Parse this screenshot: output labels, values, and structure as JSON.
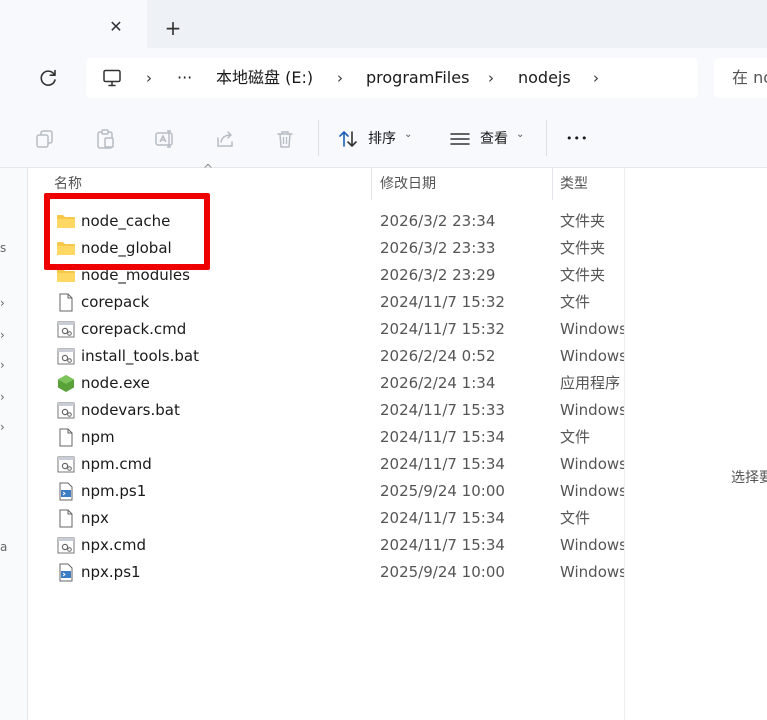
{
  "tab": {
    "close_glyph": "✕",
    "new_glyph": "+"
  },
  "address": {
    "overflow": "···",
    "crumbs": [
      "本地磁盘 (E:)",
      "programFiles",
      "nodejs"
    ],
    "separator": "›"
  },
  "search": {
    "placeholder": "在 no"
  },
  "toolbar": {
    "sort_label": "排序",
    "view_label": "查看",
    "more_glyph": "•••",
    "chevron": "⌄"
  },
  "columns": {
    "name": "名称",
    "date": "修改日期",
    "type": "类型"
  },
  "files": [
    {
      "name": "node_cache",
      "date": "2026/3/2 23:34",
      "type": "文件夹",
      "icon": "folder-icon"
    },
    {
      "name": "node_global",
      "date": "2026/3/2 23:33",
      "type": "文件夹",
      "icon": "folder-icon"
    },
    {
      "name": "node_modules",
      "date": "2026/3/2 23:29",
      "type": "文件夹",
      "icon": "folder-icon"
    },
    {
      "name": "corepack",
      "date": "2024/11/7 15:32",
      "type": "文件",
      "icon": "file-icon"
    },
    {
      "name": "corepack.cmd",
      "date": "2024/11/7 15:32",
      "type": "Windows",
      "icon": "batch-file-icon"
    },
    {
      "name": "install_tools.bat",
      "date": "2026/2/24 0:52",
      "type": "Windows",
      "icon": "batch-file-icon"
    },
    {
      "name": "node.exe",
      "date": "2026/2/24 1:34",
      "type": "应用程序",
      "icon": "node-exe-icon"
    },
    {
      "name": "nodevars.bat",
      "date": "2024/11/7 15:33",
      "type": "Windows",
      "icon": "batch-file-icon"
    },
    {
      "name": "npm",
      "date": "2024/11/7 15:34",
      "type": "文件",
      "icon": "file-icon"
    },
    {
      "name": "npm.cmd",
      "date": "2024/11/7 15:34",
      "type": "Windows",
      "icon": "batch-file-icon"
    },
    {
      "name": "npm.ps1",
      "date": "2025/9/24 10:00",
      "type": "Windows",
      "icon": "powershell-file-icon"
    },
    {
      "name": "npx",
      "date": "2024/11/7 15:34",
      "type": "文件",
      "icon": "file-icon"
    },
    {
      "name": "npx.cmd",
      "date": "2024/11/7 15:34",
      "type": "Windows",
      "icon": "batch-file-icon"
    },
    {
      "name": "npx.ps1",
      "date": "2025/9/24 10:00",
      "type": "Windows",
      "icon": "powershell-file-icon"
    }
  ],
  "detail": {
    "text": "选择要"
  },
  "nav_glyphs": {
    "s": "s",
    "a": "a",
    "chevron": "›"
  },
  "colors": {
    "highlight": "#ee0000",
    "folder": "#f5c84a",
    "node": "#5aa13a",
    "ps": "#3c7dc4"
  }
}
